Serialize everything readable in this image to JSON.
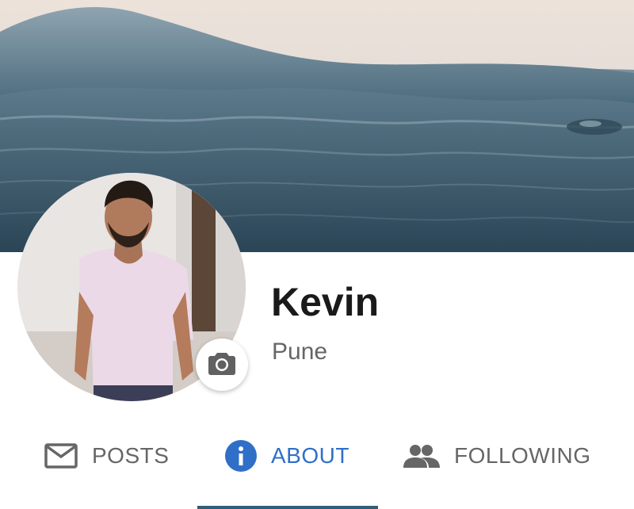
{
  "profile": {
    "name": "Kevin",
    "location": "Pune"
  },
  "tabs": [
    {
      "label": "POSTS",
      "icon": "mail-icon",
      "active": false
    },
    {
      "label": "ABOUT",
      "icon": "info-icon",
      "active": true
    },
    {
      "label": "FOLLOWING",
      "icon": "people-icon",
      "active": false
    }
  ],
  "colors": {
    "accent": "#2f6fc8",
    "indicator": "#2f5f78",
    "text_primary": "#1a1a1a",
    "text_secondary": "#666666"
  },
  "icons": {
    "camera": "camera-icon"
  }
}
